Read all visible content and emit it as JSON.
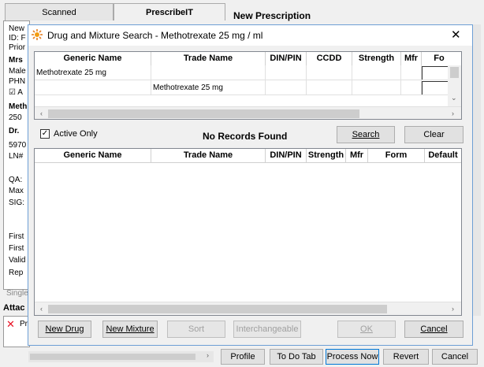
{
  "bg": {
    "tab_scanned": "Scanned",
    "tab_prescribeit": "PrescribeIT",
    "section_title": "New Prescription",
    "left_fragments": [
      "New",
      "ID: F",
      "Prior",
      "Mrs",
      "Male",
      "PHN",
      "A",
      "Meth",
      "250",
      "Dr.",
      "5970",
      "LN#",
      "QA:",
      "Max",
      "SIG:",
      "First",
      "First",
      "Valid",
      "Rep",
      "Single",
      "Attac",
      "Pr"
    ],
    "btn_profile": "Profile",
    "btn_todo": "To Do Tab",
    "btn_process": "Process Now",
    "btn_revert": "Revert",
    "btn_cancel": "Cancel"
  },
  "dialog": {
    "title": "Drug and Mixture Search - Methotrexate 25 mg / ml",
    "close_glyph": "✕",
    "search_columns": [
      "Generic Name",
      "Trade Name",
      "DIN/PIN",
      "CCDD",
      "Strength",
      "Mfr",
      "Fo"
    ],
    "search_row1_generic": "Methotrexate 25 mg",
    "search_row2_trade": "Methotrexate 25 mg",
    "active_only_label": "Active Only",
    "active_only_checked": true,
    "status_text": "No Records Found",
    "search_button": "Search",
    "clear_button": "Clear",
    "results_columns": [
      "Generic Name",
      "Trade Name",
      "DIN/PIN",
      "Strength",
      "Mfr",
      "Form",
      "Default"
    ],
    "new_drug_button": "New Drug",
    "new_mixture_button": "New Mixture",
    "sort_button": "Sort",
    "interchangeable_button": "Interchangeable",
    "ok_button": "OK",
    "cancel_button": "Cancel"
  },
  "colors": {
    "accent": "#0078d7",
    "disabled_text": "#a0a0a0",
    "error_x": "#e81123"
  }
}
